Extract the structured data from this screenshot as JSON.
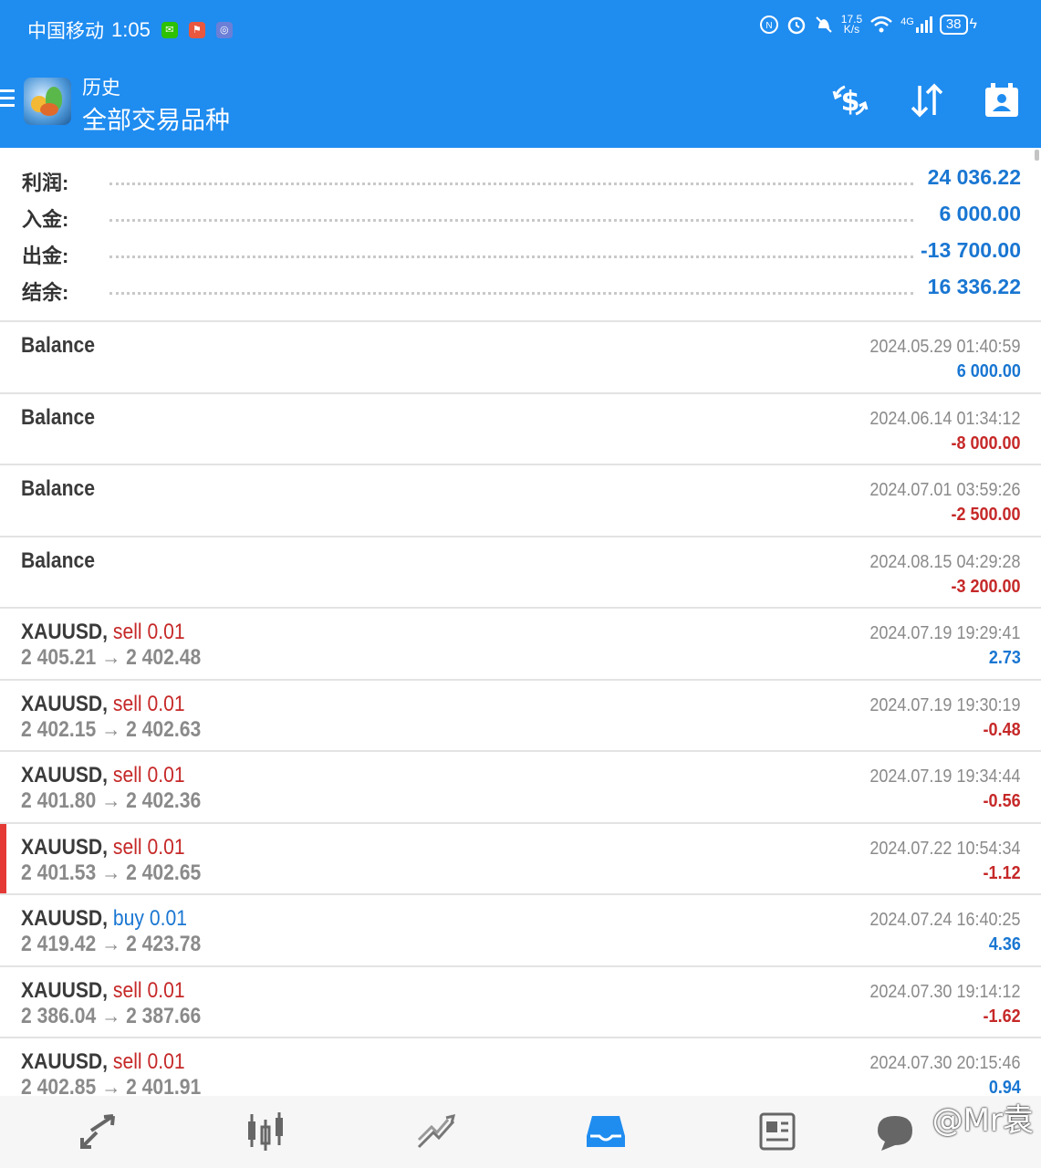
{
  "status_bar": {
    "carrier": "中国移动",
    "time": "1:05",
    "speed_value": "17.5",
    "speed_unit": "K/s",
    "network": "4G",
    "battery": "38"
  },
  "header": {
    "subtitle": "历史",
    "title": "全部交易品种",
    "brand_color": "#1f8cf0"
  },
  "summary": [
    {
      "label": "利润:",
      "value": "24 036.22"
    },
    {
      "label": "入金:",
      "value": "6 000.00"
    },
    {
      "label": "出金:",
      "value": "-13 700.00"
    },
    {
      "label": "结余:",
      "value": "16 336.22"
    }
  ],
  "history": [
    {
      "symbol": "Balance",
      "datetime": "2024.05.29 01:40:59",
      "amount": "6 000.00"
    },
    {
      "symbol": "Balance",
      "datetime": "2024.06.14 01:34:12",
      "amount": "-8 000.00"
    },
    {
      "symbol": "Balance",
      "datetime": "2024.07.01 03:59:26",
      "amount": "-2 500.00"
    },
    {
      "symbol": "Balance",
      "datetime": "2024.08.15 04:29:28",
      "amount": "-3 200.00"
    },
    {
      "symbol": "XAUUSD,",
      "action": "sell 0.01",
      "prices": "2 405.21 → 2 402.48",
      "datetime": "2024.07.19 19:29:41",
      "amount": "2.73"
    },
    {
      "symbol": "XAUUSD,",
      "action": "sell 0.01",
      "prices": "2 402.15 → 2 402.63",
      "datetime": "2024.07.19 19:30:19",
      "amount": "-0.48"
    },
    {
      "symbol": "XAUUSD,",
      "action": "sell 0.01",
      "prices": "2 401.80 → 2 402.36",
      "datetime": "2024.07.19 19:34:44",
      "amount": "-0.56"
    },
    {
      "symbol": "XAUUSD,",
      "action": "sell 0.01",
      "prices": "2 401.53 → 2 402.65",
      "datetime": "2024.07.22 10:54:34",
      "amount": "-1.12",
      "marked": true
    },
    {
      "symbol": "XAUUSD,",
      "action": "buy 0.01",
      "prices": "2 419.42 → 2 423.78",
      "datetime": "2024.07.24 16:40:25",
      "amount": "4.36"
    },
    {
      "symbol": "XAUUSD,",
      "action": "sell 0.01",
      "prices": "2 386.04 → 2 387.66",
      "datetime": "2024.07.30 19:14:12",
      "amount": "-1.62"
    },
    {
      "symbol": "XAUUSD,",
      "action": "sell 0.01",
      "prices": "2 402.85 → 2 401.91",
      "datetime": "2024.07.30 20:15:46",
      "amount": "0.94"
    }
  ],
  "bottom_nav": {
    "items": [
      "trade-icon",
      "chart-icon",
      "trend-icon",
      "history-icon",
      "news-icon",
      "chat-icon"
    ],
    "active": "history-icon",
    "active_color": "#1f8cf0"
  },
  "watermark": "@Mr袁"
}
